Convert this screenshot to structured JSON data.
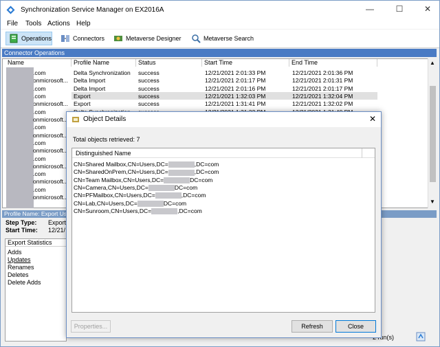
{
  "window": {
    "title": "Synchronization Service Manager on EX2016A",
    "min": "—",
    "max": "☐",
    "close": "✕"
  },
  "menu": [
    "File",
    "Tools",
    "Actions",
    "Help"
  ],
  "toolbar": [
    {
      "label": "Operations",
      "icon": "operations-icon"
    },
    {
      "label": "Connectors",
      "icon": "connectors-icon"
    },
    {
      "label": "Metaverse Designer",
      "icon": "metaverse-designer-icon"
    },
    {
      "label": "Metaverse Search",
      "icon": "metaverse-search-icon"
    }
  ],
  "connector_ops": {
    "header": "Connector Operations",
    "columns": [
      "Name",
      "Profile Name",
      "Status",
      "Start Time",
      "End Time"
    ],
    "rows": [
      {
        "name": ".com",
        "profile": "Delta Synchronization",
        "status": "success",
        "start": "12/21/2021 2:01:33 PM",
        "end": "12/21/2021 2:01:36 PM"
      },
      {
        "name": "onmicrosoft...",
        "profile": "Delta Import",
        "status": "success",
        "start": "12/21/2021 2:01:17 PM",
        "end": "12/21/2021 2:01:31 PM"
      },
      {
        "name": ".com",
        "profile": "Delta Import",
        "status": "success",
        "start": "12/21/2021 2:01:16 PM",
        "end": "12/21/2021 2:01:17 PM"
      },
      {
        "name": ".com",
        "profile": "Export",
        "status": "success",
        "start": "12/21/2021 1:32:03 PM",
        "end": "12/21/2021 1:32:04 PM"
      },
      {
        "name": "onmicrosoft...",
        "profile": "Export",
        "status": "success",
        "start": "12/21/2021 1:31:41 PM",
        "end": "12/21/2021 1:32:02 PM"
      },
      {
        "name": ".com",
        "profile": "Delta Synchronization",
        "status": "success",
        "start": "12/21/2021 1:31:32 PM",
        "end": "12/21/2021 1:31:40 PM"
      }
    ],
    "hidden_names": [
      "onmicrosoft...",
      ".com",
      "onmicrosoft...",
      ".com",
      "onmicrosoft...",
      ".com",
      "onmicrosoft...",
      ".com",
      "onmicrosoft...",
      ".com",
      "onmicrosoft..."
    ]
  },
  "lower": {
    "profile_header": "Profile Name: Export  Us",
    "step_type_label": "Step Type:",
    "step_type_value": "Export",
    "start_time_label": "Start Time:",
    "start_time_value": "12/21/",
    "stats_title": "Export Statistics",
    "stats": [
      "Adds",
      "Updates",
      "Renames",
      "Deletes",
      "Delete Adds"
    ],
    "runs": "2 run(s)"
  },
  "dialog": {
    "title": "Object Details",
    "close": "✕",
    "total": "Total objects retrieved: 7",
    "column": "Distinguished Name",
    "rows": [
      {
        "pre": "CN=Shared Mailbox,CN=Users,DC=",
        "post": ",DC=com"
      },
      {
        "pre": "CN=SharedOnPrem,CN=Users,DC=",
        "post": ",DC=com"
      },
      {
        "pre": "CN=Team Mailbox,CN=Users,DC=",
        "post": "DC=com"
      },
      {
        "pre": "CN=Camera,CN=Users,DC=",
        "post": "DC=com"
      },
      {
        "pre": "CN=PFMailbox,CN=Users,DC=",
        "post": ",DC=com"
      },
      {
        "pre": "CN=Lab,CN=Users,DC=",
        "post": "DC=com"
      },
      {
        "pre": "CN=Sunroom,CN=Users,DC=",
        "post": ",DC=com"
      }
    ],
    "properties_btn": "Properties...",
    "refresh_btn": "Refresh",
    "close_btn": "Close"
  }
}
